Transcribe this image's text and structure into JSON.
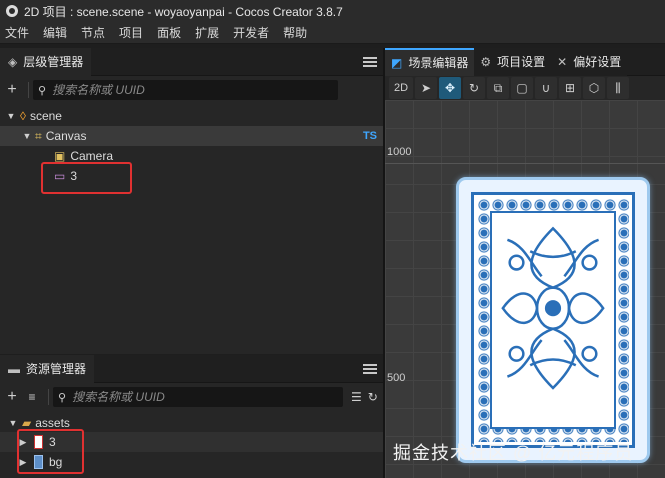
{
  "window": {
    "title": "2D 项目 : scene.scene - woyaoyanpai - Cocos Creator 3.8.7"
  },
  "menu": [
    "文件",
    "编辑",
    "节点",
    "项目",
    "面板",
    "扩展",
    "开发者",
    "帮助"
  ],
  "hierarchy": {
    "tab_label": "层级管理器",
    "search_placeholder": "搜索名称或 UUID",
    "nodes": {
      "scene": "scene",
      "canvas": "Canvas",
      "canvas_badge": "TS",
      "camera": "Camera",
      "sprite": "3"
    }
  },
  "assets": {
    "tab_label": "资源管理器",
    "search_placeholder": "搜索名称或 UUID",
    "root": "assets",
    "items": [
      "3",
      "bg"
    ]
  },
  "scene_panel": {
    "tabs": [
      "场景编辑器",
      "项目设置",
      "偏好设置"
    ],
    "toolbar_first": "2D",
    "axis_labels": [
      "1000",
      "500"
    ]
  },
  "watermark": "掘金技术社区 @ 亿元程序员",
  "colors": {
    "accent": "#3fa7ff",
    "highlight_box": "#e03131",
    "card_blue": "#2a6fb8"
  }
}
